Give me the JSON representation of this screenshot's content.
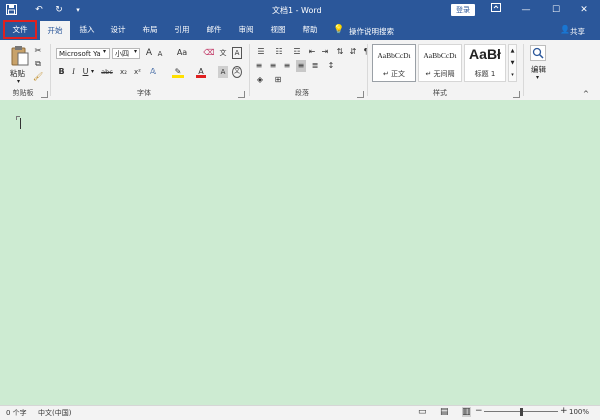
{
  "window": {
    "title": "文档1 - Word",
    "login_label": "登录"
  },
  "tabs": [
    "文件",
    "开始",
    "插入",
    "设计",
    "布局",
    "引用",
    "邮件",
    "审阅",
    "视图",
    "帮助"
  ],
  "tell_me": "操作说明搜索",
  "share": "共享",
  "ribbon": {
    "clipboard": {
      "paste": "粘贴",
      "label": "剪贴板"
    },
    "font": {
      "name": "Microsoft Ya",
      "size": "小四",
      "label": "字体",
      "grow": "A",
      "shrink": "A",
      "case": "Aa",
      "bold": "B",
      "italic": "I",
      "underline": "U",
      "strike": "abc",
      "subscript": "x₂",
      "superscript": "x²",
      "font_color": "A",
      "wen": "文",
      "wen2": "A"
    },
    "paragraph": {
      "label": "段落"
    },
    "styles": {
      "label": "样式",
      "items": [
        {
          "sample": "AaBbCcDı",
          "name": "↵ 正文"
        },
        {
          "sample": "AaBbCcDı",
          "name": "↵ 无间隔"
        },
        {
          "sample": "AaBł",
          "name": "标题 1"
        }
      ]
    },
    "editing": {
      "label": "编辑"
    }
  },
  "status": {
    "words": "0 个字",
    "language": "中文(中国)",
    "zoom": "100%"
  }
}
